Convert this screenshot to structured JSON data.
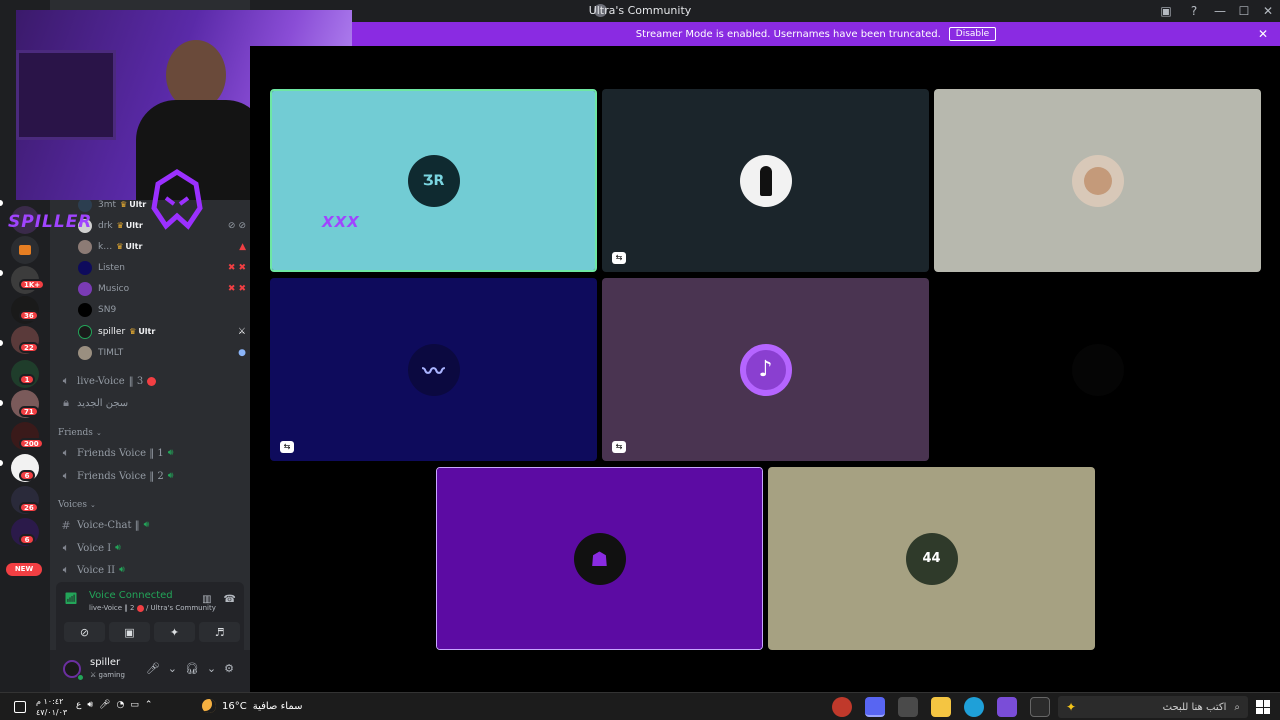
{
  "window": {
    "title": "Ultra's Community"
  },
  "banner": {
    "message": "Streamer Mode is enabled. Usernames have been truncated.",
    "disable_label": "Disable"
  },
  "servers": {
    "badges": [
      "1K+",
      "36",
      "22",
      "1",
      "71",
      "200",
      "6",
      "26",
      "6"
    ],
    "new_label": "NEW"
  },
  "overlay": {
    "brand_text": "SPILLER",
    "watermark_text": "XXX"
  },
  "voice_users": [
    {
      "name": "3mt",
      "role": "Ultr"
    },
    {
      "name": "drk",
      "role": "Ultr"
    },
    {
      "name": "k…",
      "role": "Ultr"
    },
    {
      "name": "Listen",
      "role": ""
    },
    {
      "name": "Musico",
      "role": ""
    },
    {
      "name": "SN9",
      "role": ""
    },
    {
      "name": "spiller",
      "role": "Ultr"
    },
    {
      "name": "TIMLT",
      "role": ""
    }
  ],
  "channels": {
    "live_voice": {
      "name": "live-Voice",
      "suffix": "‖ 3"
    },
    "jail": {
      "name": "سجن الجديد"
    },
    "friends_category": "Friends",
    "friends_voice_1": "Friends Voice ‖ 1",
    "friends_voice_2": "Friends Voice ‖ 2",
    "voices_category": "Voices",
    "voice_chat": "Voice-Chat ‖",
    "voice_1": "Voice I",
    "voice_2": "Voice II"
  },
  "voice_connected": {
    "status": "Voice Connected",
    "channel": "live-Voice ‖ 2",
    "server": "/ Ultra's Community"
  },
  "user_panel": {
    "name": "spiller",
    "status": "gaming"
  },
  "tiles": [
    {
      "bg": "#72ccd4",
      "avatar_text": "ƷR"
    },
    {
      "bg": "#1b252b",
      "avatar_text": ""
    },
    {
      "bg": "#b7b8ae",
      "avatar_text": ""
    },
    {
      "bg": "#0e0b5c",
      "avatar_text": ""
    },
    {
      "bg": "#4a3451",
      "avatar_text": "♪"
    },
    {
      "bg": "#000000",
      "avatar_text": ""
    },
    {
      "bg": "#5c0ba3",
      "avatar_text": ""
    },
    {
      "bg": "#a6a182",
      "avatar_text": "44"
    }
  ],
  "taskbar": {
    "time": "١٠:٤٢ م",
    "date": "٤٧/٠١/٠٣",
    "lang": "ع",
    "temperature": "16°C",
    "weather_text": "سماء صافية",
    "search_placeholder": "اكتب هنا للبحث"
  }
}
